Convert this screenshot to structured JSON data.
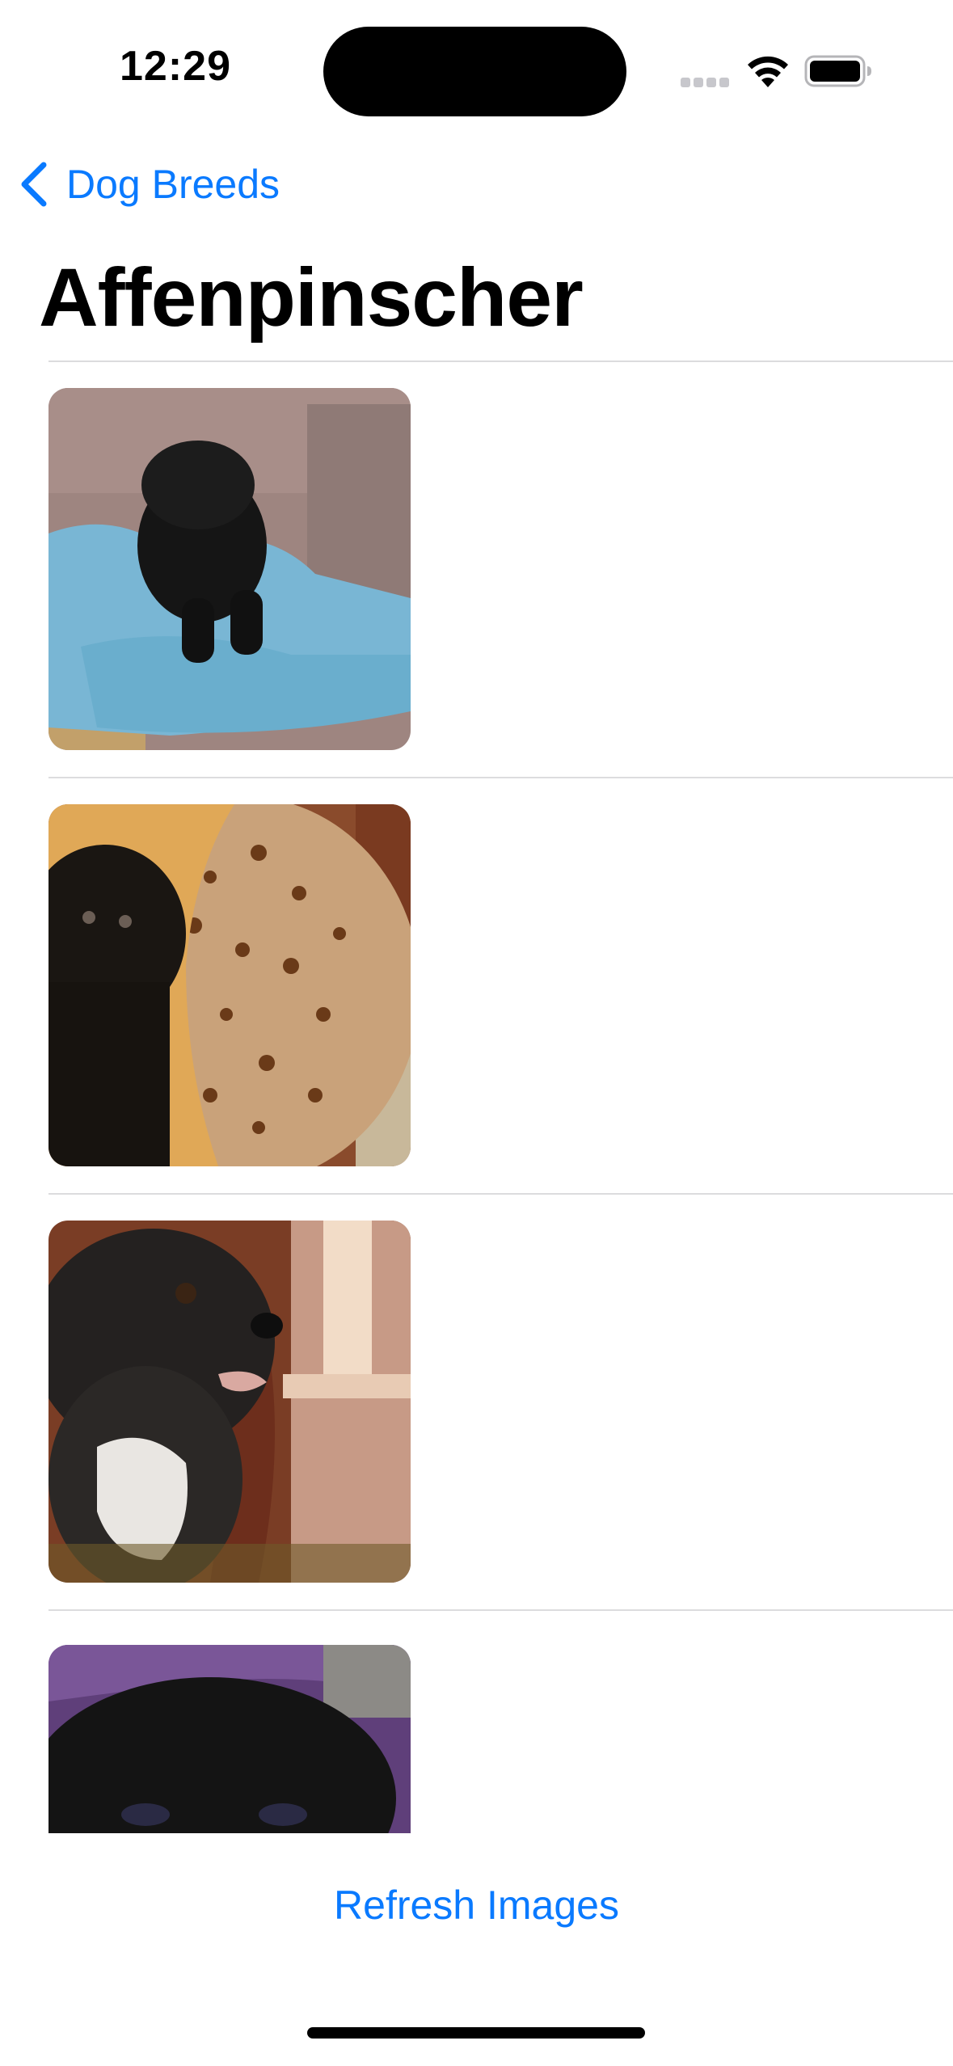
{
  "status_bar": {
    "time": "12:29",
    "icons": [
      "cellular-signal-icon",
      "wifi-icon",
      "battery-icon"
    ]
  },
  "nav": {
    "back_label": "Dog Breeds",
    "back_icon": "chevron-left-icon",
    "title": "Affenpinscher"
  },
  "images": [
    {
      "subject": "black puppy on blue blanket in wicker basket"
    },
    {
      "subject": "black dog peeking from leopard print pet bed"
    },
    {
      "subject": "shaggy black dog with tag near window"
    },
    {
      "subject": "black dog on purple blanket"
    }
  ],
  "footer": {
    "refresh_label": "Refresh Images"
  },
  "colors": {
    "accent": "#0a7aff",
    "divider": "#dcdcde",
    "background": "#ffffff"
  }
}
